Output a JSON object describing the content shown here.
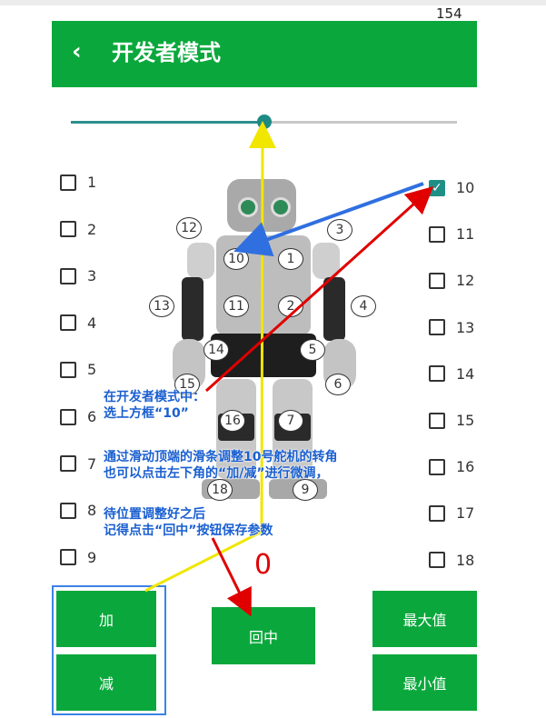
{
  "status_bar": {
    "time": "154"
  },
  "appbar": {
    "back_glyph": "‹",
    "title": "开发者模式"
  },
  "slider": {
    "value_fraction": 0.5
  },
  "checkboxes_left": [
    {
      "label": "1",
      "checked": false
    },
    {
      "label": "2",
      "checked": false
    },
    {
      "label": "3",
      "checked": false
    },
    {
      "label": "4",
      "checked": false
    },
    {
      "label": "5",
      "checked": false
    },
    {
      "label": "6",
      "checked": false
    },
    {
      "label": "7",
      "checked": false
    },
    {
      "label": "8",
      "checked": false
    },
    {
      "label": "9",
      "checked": false
    }
  ],
  "checkboxes_right": [
    {
      "label": "10",
      "checked": true
    },
    {
      "label": "11",
      "checked": false
    },
    {
      "label": "12",
      "checked": false
    },
    {
      "label": "13",
      "checked": false
    },
    {
      "label": "14",
      "checked": false
    },
    {
      "label": "15",
      "checked": false
    },
    {
      "label": "16",
      "checked": false
    },
    {
      "label": "17",
      "checked": false
    },
    {
      "label": "18",
      "checked": false
    }
  ],
  "robot_badges": [
    "12",
    "3",
    "10",
    "1",
    "13",
    "11",
    "2",
    "4",
    "14",
    "5",
    "15",
    "6",
    "16",
    "7",
    "18",
    "9"
  ],
  "counter_value": "0",
  "buttons": {
    "plus": "加",
    "minus": "减",
    "center": "回中",
    "max": "最大值",
    "min": "最小值"
  },
  "annotations": {
    "block1_line1": "在开发者模式中：",
    "block1_line2": "选上方框“10”",
    "block2_line1": "通过滑动顶端的滑条调整10号舵机的转角",
    "block2_line2": "也可以点击左下角的“加/减”进行微调，",
    "block3_line1": "待位置调整好之后",
    "block3_line2": "记得点击“回中”按钮保存参数"
  },
  "colors": {
    "primary_green": "#0aa83c",
    "accent_teal": "#1f8f86",
    "counter_red": "#e10000",
    "annotation_blue": "#1a5fd0"
  }
}
